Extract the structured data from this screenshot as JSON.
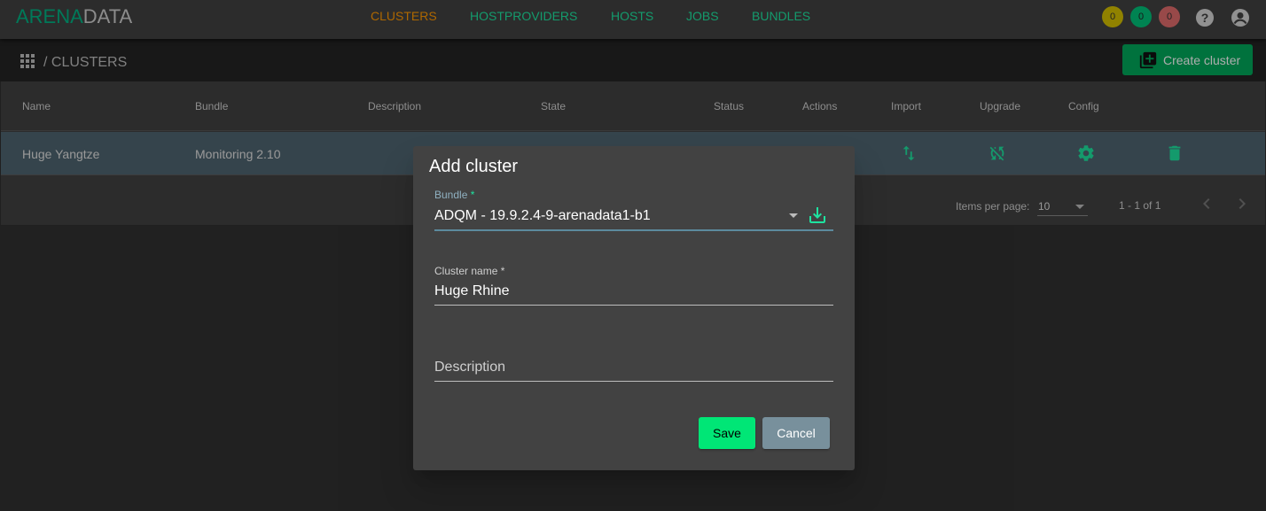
{
  "app": {
    "logo_part1": "ARENA",
    "logo_part2": "DATA"
  },
  "nav": {
    "items": [
      {
        "label": "CLUSTERS",
        "active": true
      },
      {
        "label": "HOSTPROVIDERS",
        "active": false
      },
      {
        "label": "HOSTS",
        "active": false
      },
      {
        "label": "JOBS",
        "active": false
      },
      {
        "label": "BUNDLES",
        "active": false
      }
    ]
  },
  "badges": {
    "yellow": "0",
    "green": "0",
    "red": "0"
  },
  "breadcrumb": {
    "current": "CLUSTERS"
  },
  "toolbar": {
    "create_label": "Create cluster"
  },
  "table": {
    "columns": [
      "Name",
      "Bundle",
      "Description",
      "State",
      "Status",
      "Actions",
      "Import",
      "Upgrade",
      "Config"
    ],
    "rows": [
      {
        "name": "Huge Yangtze",
        "bundle": "Monitoring 2.10",
        "description": "",
        "state": ""
      }
    ]
  },
  "paginator": {
    "items_per_page_label": "Items per page:",
    "page_size": "10",
    "range_label": "1 - 1 of 1"
  },
  "dialog": {
    "title": "Add cluster",
    "bundle_label": "Bundle",
    "bundle_required": " *",
    "bundle_value": "ADQM - 19.9.2.4-9-arenadata1-b1",
    "name_label": "Cluster name *",
    "name_value": "Huge Rhine",
    "description_placeholder": "Description",
    "save_label": "Save",
    "cancel_label": "Cancel"
  },
  "colors": {
    "accent": "#1ee3a0",
    "active_nav": "#ff9800",
    "primary_button": "#00a85a",
    "save_button": "#00e676",
    "cancel_button": "#78909c"
  }
}
